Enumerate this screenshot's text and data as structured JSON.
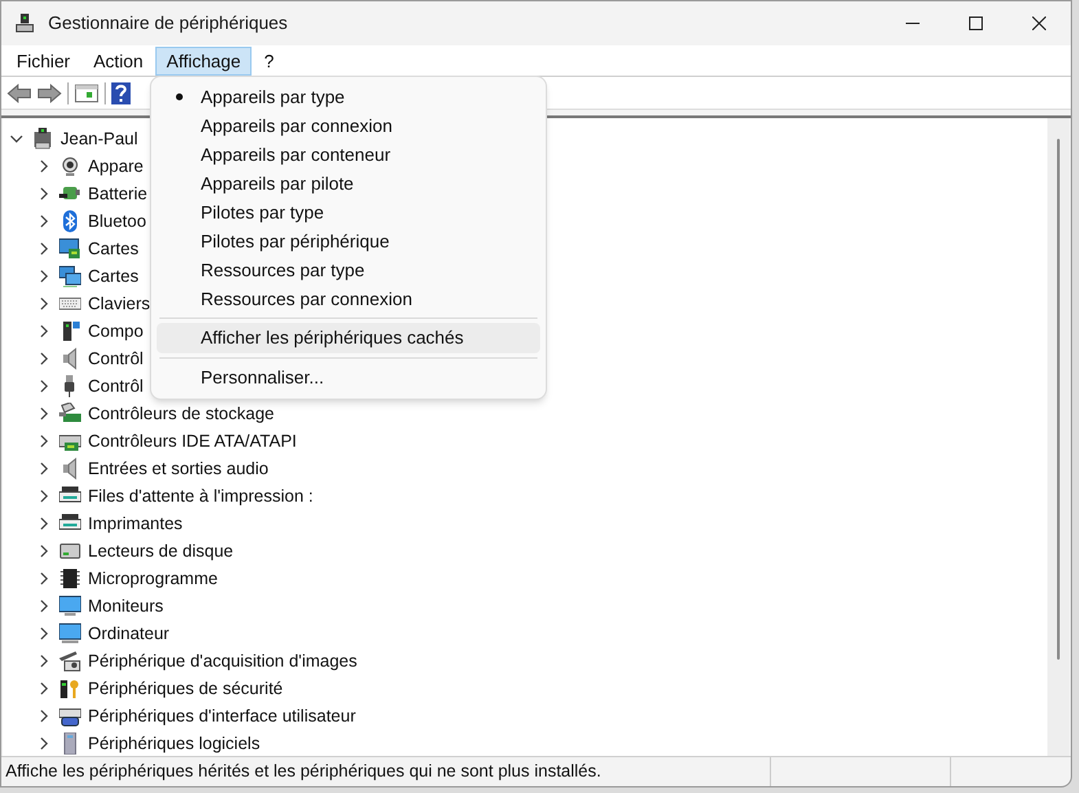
{
  "window": {
    "title": "Gestionnaire de périphériques"
  },
  "menu_bar": [
    {
      "label": "Fichier",
      "selected": false
    },
    {
      "label": "Action",
      "selected": false
    },
    {
      "label": "Affichage",
      "selected": true
    },
    {
      "label": "?",
      "selected": false
    }
  ],
  "tree": {
    "label": "Jean-Paul",
    "expanded": true,
    "children": [
      {
        "label": "Appare",
        "expanded": false
      },
      {
        "label": "Batterie",
        "expanded": false
      },
      {
        "label": "Bluetoo",
        "expanded": false
      },
      {
        "label": "Cartes",
        "expanded": false
      },
      {
        "label": "Cartes",
        "expanded": false
      },
      {
        "label": "Claviers",
        "expanded": false
      },
      {
        "label": "Compo",
        "expanded": false
      },
      {
        "label": "Contrôl",
        "expanded": false
      },
      {
        "label": "Contrôl",
        "expanded": false
      },
      {
        "label": "Contrôleurs de stockage",
        "expanded": false
      },
      {
        "label": "Contrôleurs IDE ATA/ATAPI",
        "expanded": false
      },
      {
        "label": "Entrées et sorties audio",
        "expanded": false
      },
      {
        "label": "Files d'attente à l'impression :",
        "expanded": false
      },
      {
        "label": "Imprimantes",
        "expanded": false
      },
      {
        "label": "Lecteurs de disque",
        "expanded": false
      },
      {
        "label": "Microprogramme",
        "expanded": false
      },
      {
        "label": "Moniteurs",
        "expanded": false
      },
      {
        "label": "Ordinateur",
        "expanded": false
      },
      {
        "label": "Périphérique d'acquisition d'images",
        "expanded": false
      },
      {
        "label": "Périphériques de sécurité",
        "expanded": false
      },
      {
        "label": "Périphériques d'interface utilisateur",
        "expanded": false
      },
      {
        "label": "Périphériques logiciels",
        "expanded": false
      }
    ]
  },
  "dropdown": [
    {
      "kind": "radio",
      "label": "Appareils par type",
      "selected": true
    },
    {
      "kind": "radio",
      "label": "Appareils par connexion",
      "selected": false
    },
    {
      "kind": "radio",
      "label": "Appareils par conteneur",
      "selected": false
    },
    {
      "kind": "radio",
      "label": "Appareils par pilote",
      "selected": false
    },
    {
      "kind": "radio",
      "label": "Pilotes par type",
      "selected": false
    },
    {
      "kind": "radio",
      "label": "Pilotes par périphérique",
      "selected": false
    },
    {
      "kind": "radio",
      "label": "Ressources par type",
      "selected": false
    },
    {
      "kind": "radio",
      "label": "Ressources par connexion",
      "selected": false
    },
    {
      "kind": "separator"
    },
    {
      "kind": "command",
      "label": "Afficher les périphériques cachés",
      "highlighted": true
    },
    {
      "kind": "separator"
    },
    {
      "kind": "command",
      "label": "Personnaliser...",
      "highlighted": false
    }
  ],
  "status_bar": "Affiche les périphériques hérités et les périphériques qui ne sont plus installés."
}
